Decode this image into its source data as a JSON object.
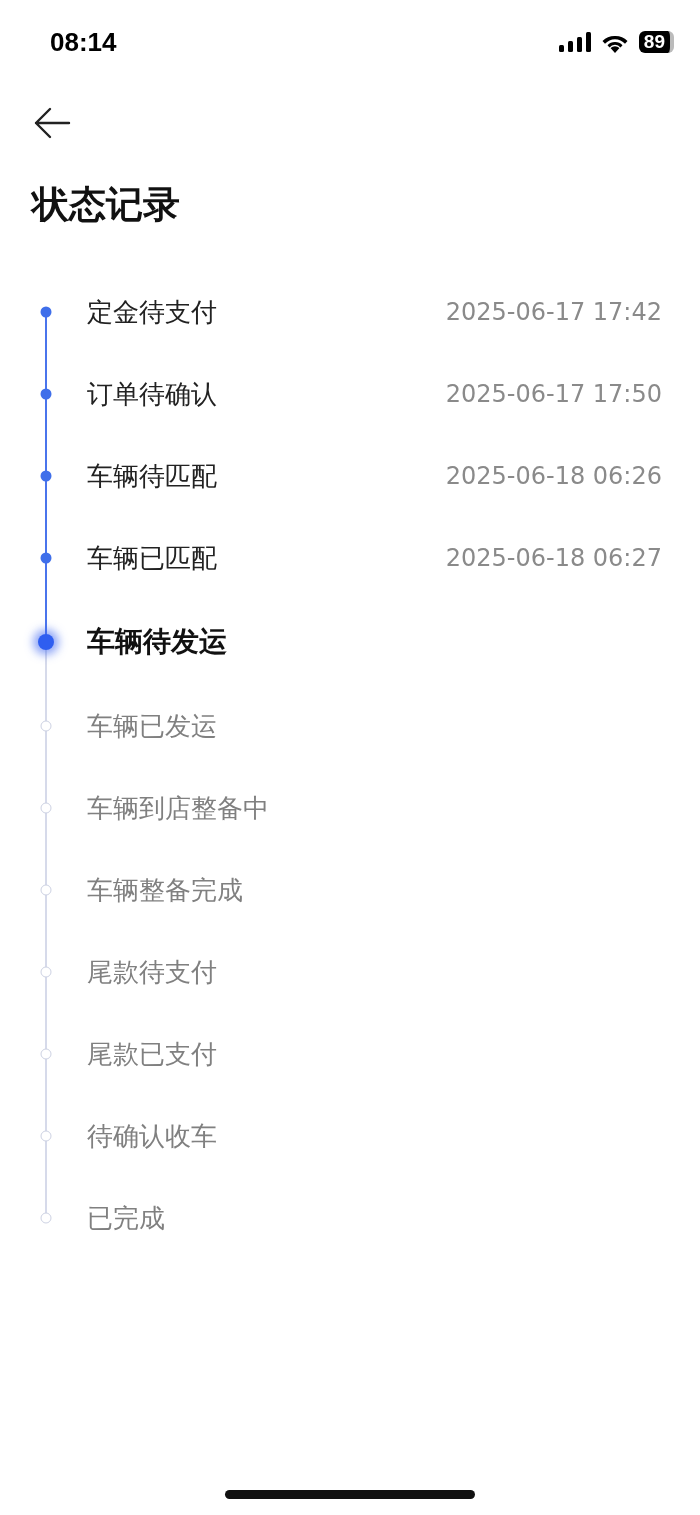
{
  "status_bar": {
    "time": "08:14",
    "battery": "89"
  },
  "title": "状态记录",
  "steps": [
    {
      "label": "定金待支付",
      "time": "2025-06-17 17:42",
      "kind": "done"
    },
    {
      "label": "订单待确认",
      "time": "2025-06-17 17:50",
      "kind": "done"
    },
    {
      "label": "车辆待匹配",
      "time": "2025-06-18 06:26",
      "kind": "done"
    },
    {
      "label": "车辆已匹配",
      "time": "2025-06-18 06:27",
      "kind": "done"
    },
    {
      "label": "车辆待发运",
      "kind": "current"
    },
    {
      "label": "车辆已发运",
      "kind": "pending"
    },
    {
      "label": "车辆到店整备中",
      "kind": "pending"
    },
    {
      "label": "车辆整备完成",
      "kind": "pending"
    },
    {
      "label": "尾款待支付",
      "kind": "pending"
    },
    {
      "label": "尾款已支付",
      "kind": "pending"
    },
    {
      "label": "待确认收车",
      "kind": "pending"
    },
    {
      "label": "已完成",
      "kind": "pending"
    }
  ]
}
